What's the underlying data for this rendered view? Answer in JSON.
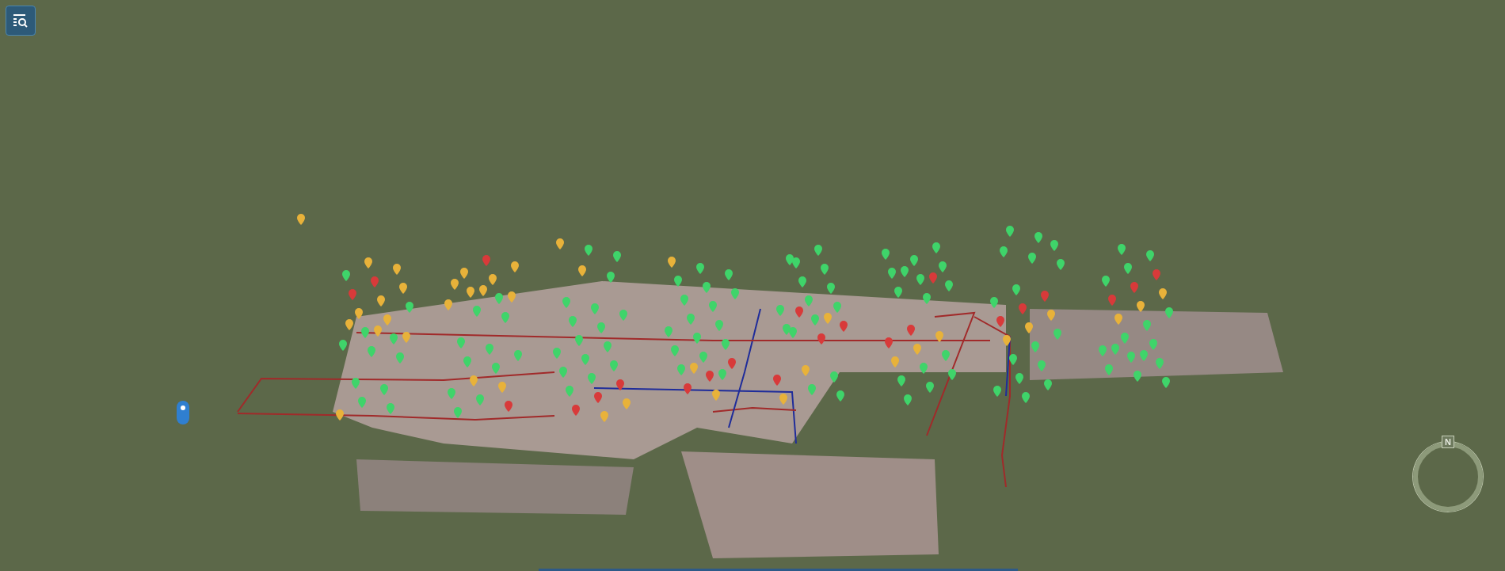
{
  "compass": {
    "north_label": "N"
  }
}
